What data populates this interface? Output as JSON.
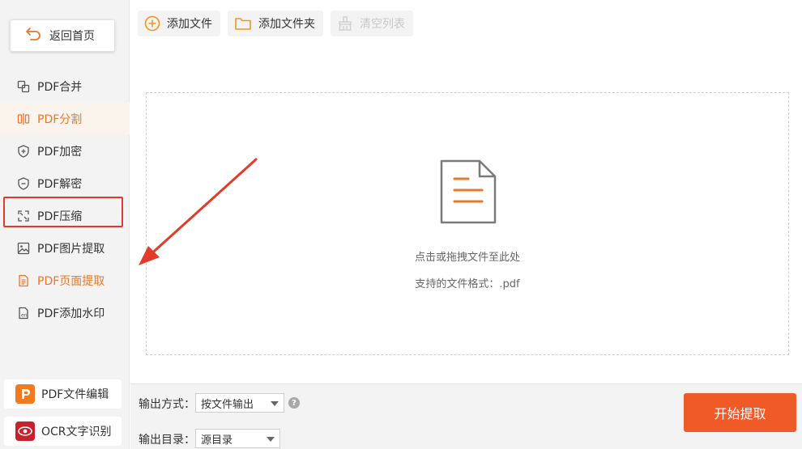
{
  "sidebar": {
    "back_label": "返回首页",
    "items": [
      {
        "label": "PDF合并",
        "icon": "merge-icon"
      },
      {
        "label": "PDF分割",
        "icon": "split-icon"
      },
      {
        "label": "PDF加密",
        "icon": "shield-plus-icon"
      },
      {
        "label": "PDF解密",
        "icon": "shield-minus-icon"
      },
      {
        "label": "PDF压缩",
        "icon": "compress-icon"
      },
      {
        "label": "PDF图片提取",
        "icon": "image-icon"
      },
      {
        "label": "PDF页面提取",
        "icon": "page-icon"
      },
      {
        "label": "PDF添加水印",
        "icon": "watermark-icon"
      }
    ],
    "tools": [
      {
        "label": "PDF文件编辑",
        "icon": "pdf-editor-logo"
      },
      {
        "label": "OCR文字识别",
        "icon": "ocr-logo"
      }
    ]
  },
  "toolbar": {
    "add_file": "添加文件",
    "add_folder": "添加文件夹",
    "clear_list": "清空列表"
  },
  "dropzone": {
    "hint": "点击或拖拽文件至此处",
    "formats": "支持的文件格式：.pdf"
  },
  "bottom": {
    "output_mode_label": "输出方式：",
    "output_mode_value": "按文件输出",
    "output_dir_label": "输出目录：",
    "output_dir_value": "源目录",
    "help": "?",
    "start_label": "开始提取"
  },
  "colors": {
    "accent": "#e8782e",
    "primary_button": "#f05a28",
    "annotation_red": "#e23b2b"
  }
}
